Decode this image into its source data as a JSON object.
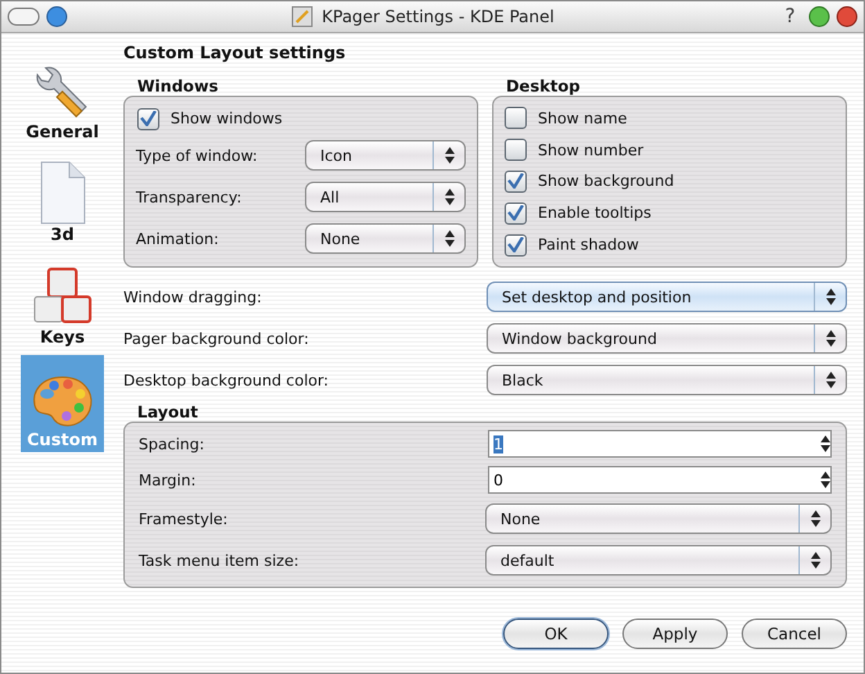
{
  "window": {
    "title": "KPager Settings - KDE Panel",
    "help": "?"
  },
  "sidebar": {
    "items": [
      {
        "label": "General",
        "selected": false
      },
      {
        "label": "3d",
        "selected": false
      },
      {
        "label": "Keys",
        "selected": false
      },
      {
        "label": "Custom",
        "selected": true
      }
    ]
  },
  "heading": "Custom Layout settings",
  "windows": {
    "title": "Windows",
    "show_windows": {
      "label": "Show windows",
      "checked": true
    },
    "fields": [
      {
        "label": "Type of window:",
        "value": "Icon"
      },
      {
        "label": "Transparency:",
        "value": "All"
      },
      {
        "label": "Animation:",
        "value": "None"
      }
    ]
  },
  "desktop": {
    "title": "Desktop",
    "options": [
      {
        "label": "Show name",
        "checked": false
      },
      {
        "label": "Show number",
        "checked": false
      },
      {
        "label": "Show background",
        "checked": true
      },
      {
        "label": "Enable tooltips",
        "checked": true
      },
      {
        "label": "Paint shadow",
        "checked": true
      }
    ]
  },
  "rows": [
    {
      "label": "Window dragging:",
      "value": "Set desktop and position",
      "focused": true
    },
    {
      "label": "Pager background color:",
      "value": "Window background",
      "focused": false
    },
    {
      "label": "Desktop background color:",
      "value": "Black",
      "focused": false
    }
  ],
  "layout": {
    "title": "Layout",
    "fields": [
      {
        "kind": "spin",
        "label": "Spacing:",
        "value": "1",
        "selected": true
      },
      {
        "kind": "spin",
        "label": "Margin:",
        "value": "0",
        "selected": false
      },
      {
        "kind": "combo",
        "label": "Framestyle:",
        "value": "None"
      },
      {
        "kind": "combo",
        "label": "Task menu item size:",
        "value": "default"
      }
    ]
  },
  "buttons": [
    {
      "label": "OK",
      "default": true
    },
    {
      "label": "Apply",
      "default": false
    },
    {
      "label": "Cancel",
      "default": false
    }
  ]
}
